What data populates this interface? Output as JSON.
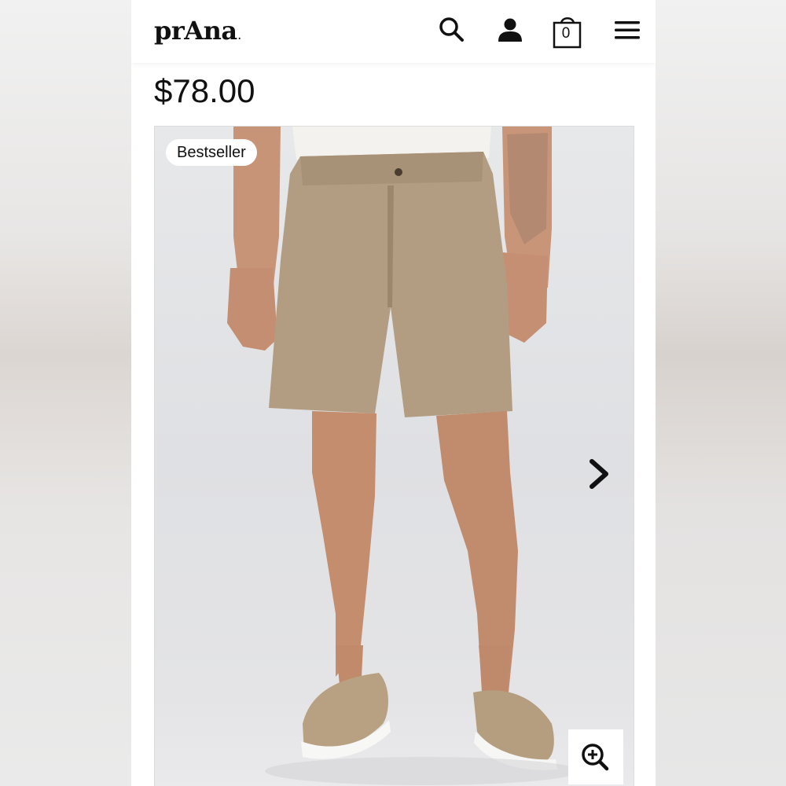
{
  "header": {
    "logo_text": "prAna",
    "logo_mark": ".",
    "cart_count": "0",
    "icons": [
      "search-icon",
      "user-icon",
      "shopping-bag-icon",
      "menu-icon"
    ]
  },
  "product": {
    "price": "$78.00",
    "badge": "Bestseller",
    "image_icons": [
      "chevron-right-icon",
      "zoom-in-icon"
    ]
  },
  "colors": {
    "text": "#111111",
    "background": "#ffffff",
    "shorts": "#b49f84"
  }
}
